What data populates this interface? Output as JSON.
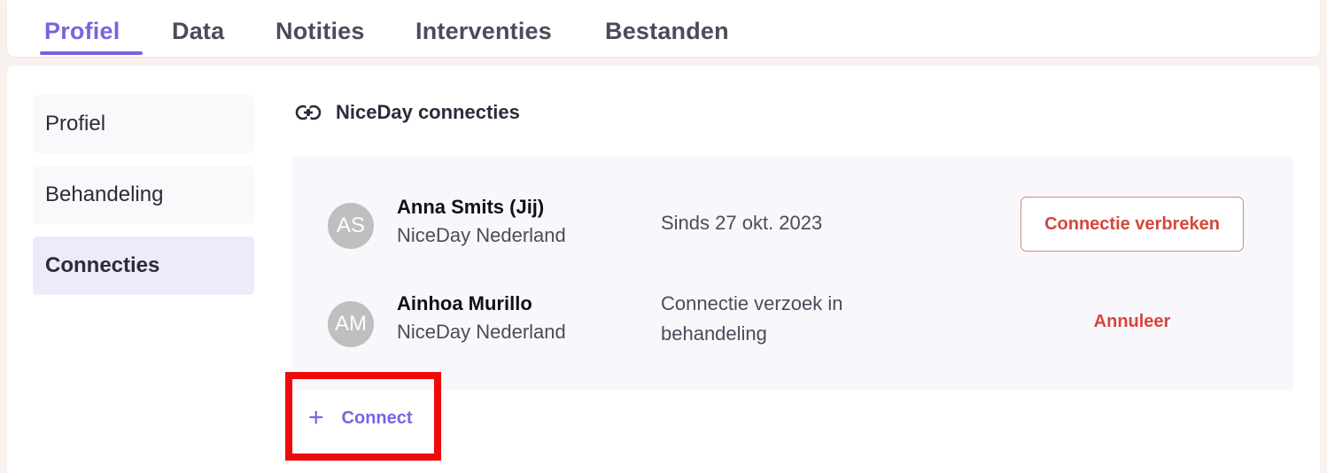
{
  "tabs": [
    {
      "label": "Profiel",
      "active": true
    },
    {
      "label": "Data",
      "active": false
    },
    {
      "label": "Notities",
      "active": false
    },
    {
      "label": "Interventies",
      "active": false
    },
    {
      "label": "Bestanden",
      "active": false
    }
  ],
  "sidebar": {
    "items": [
      {
        "label": "Profiel",
        "active": false
      },
      {
        "label": "Behandeling",
        "active": false
      },
      {
        "label": "Connecties",
        "active": true
      }
    ]
  },
  "section": {
    "title": "NiceDay connecties",
    "icon": "link-icon"
  },
  "connections": [
    {
      "initials": "AS",
      "name": "Anna Smits (Jij)",
      "organization": "NiceDay Nederland",
      "status": "Sinds 27 okt. 2023",
      "action": "Connectie verbreken"
    },
    {
      "initials": "AM",
      "name": "Ainhoa Murillo",
      "organization": "NiceDay Nederland",
      "status": "Connectie verzoek in behandeling",
      "status_line1": "Connectie verzoek in",
      "status_line2": "behandeling",
      "action": "Annuleer"
    }
  ],
  "connect_button": {
    "icon": "plus-icon",
    "label": "Connect"
  },
  "colors": {
    "accent": "#7a62e3",
    "danger": "#d4473a",
    "highlight": "#ee0a0a"
  }
}
